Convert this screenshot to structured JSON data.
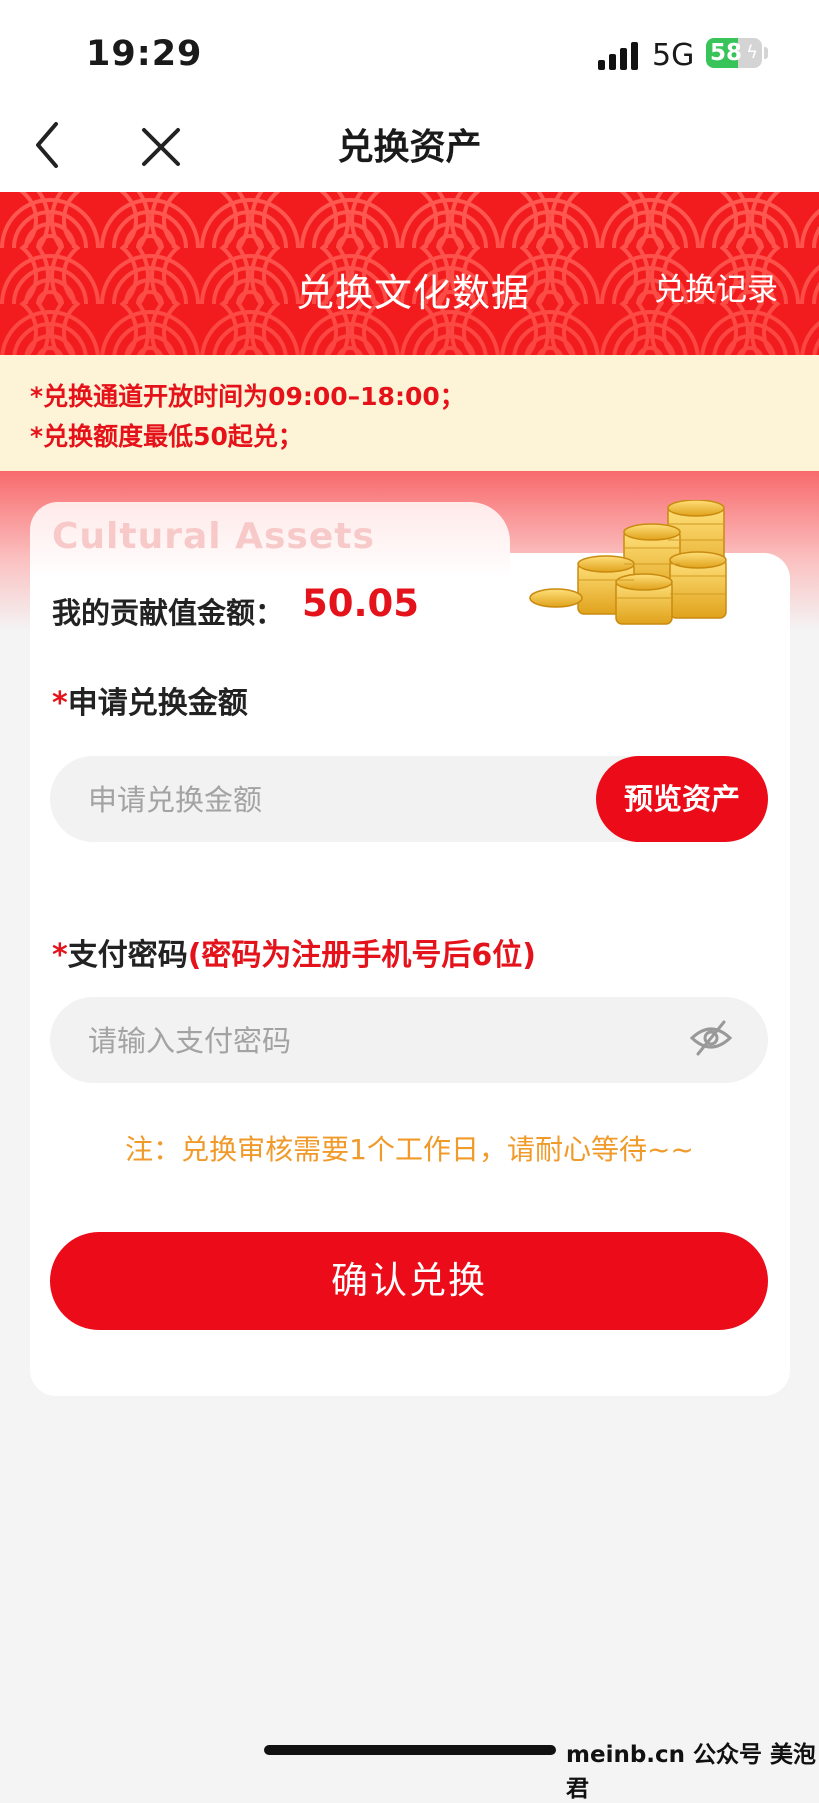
{
  "status": {
    "time": "19:29",
    "network": "5G",
    "battery": "58",
    "battery_level": 0.58
  },
  "nav": {
    "title": "兑换资产",
    "back_icon": "chevron-left-icon",
    "close_icon": "close-icon"
  },
  "banner": {
    "title": "兑换文化数据",
    "record_link": "兑换记录"
  },
  "notice": {
    "lines": [
      "*兑换通道开放时间为09:00–18:00；",
      "*兑换额度最低50起兑；"
    ]
  },
  "card": {
    "background_text": "Cultural Assets",
    "balance_label": "我的贡献值金额：",
    "balance_value": "50.05"
  },
  "form": {
    "amount": {
      "required_mark": "*",
      "label": "申请兑换金额",
      "placeholder": "申请兑换金额",
      "value": "",
      "preview_button": "预览资产"
    },
    "password": {
      "required_mark": "*",
      "label": "支付密码",
      "hint": "(密码为注册手机号后6位)",
      "placeholder": "请输入支付密码",
      "value": "",
      "toggle_icon": "eye-off-icon"
    },
    "note": "注：兑换审核需要1个工作日，请耐心等待~~",
    "submit": "确认兑换"
  },
  "watermark": "meinb.cn  公众号 美泡君",
  "colors": {
    "brand_red": "#ec0b18",
    "banner_red": "#f21c1e",
    "notice_bg": "#fdf3d6",
    "note_orange": "#f09a2a"
  }
}
